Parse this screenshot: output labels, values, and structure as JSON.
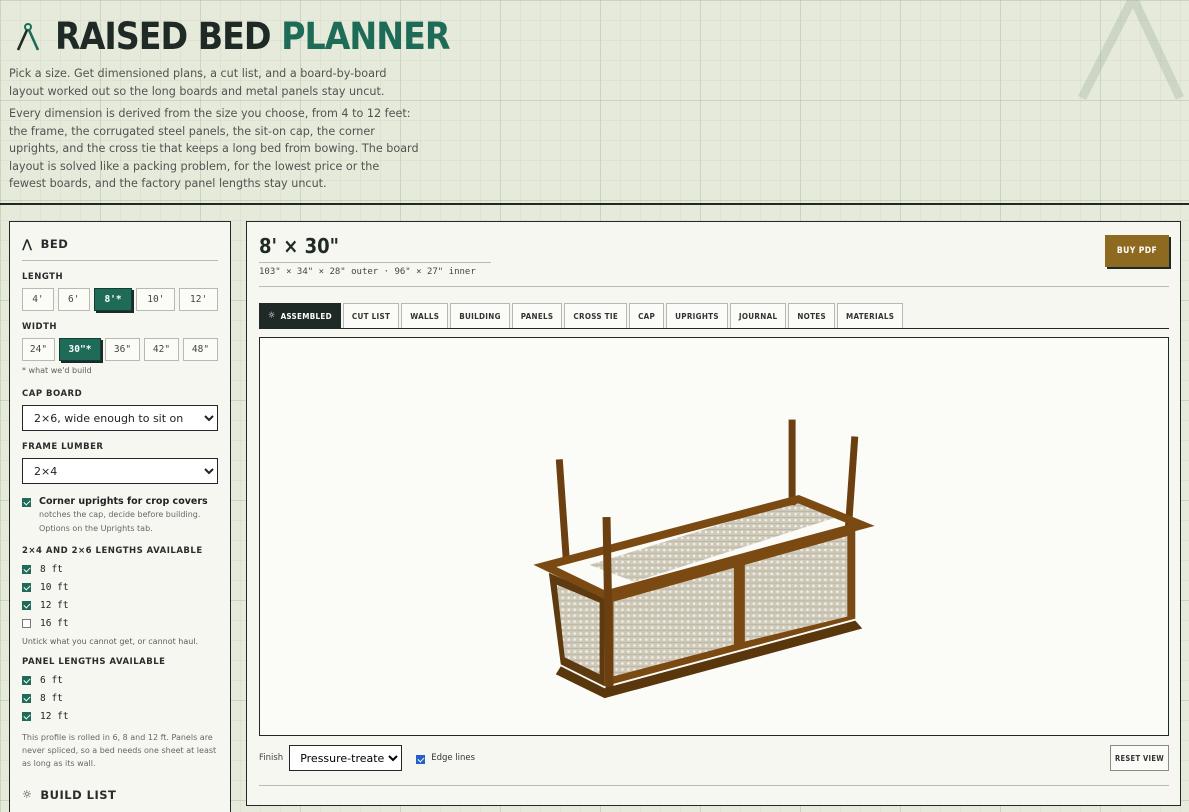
{
  "app": {
    "title_part1": "RAISED BED",
    "title_part2": "PLANNER",
    "intro1": "Pick a size. Get dimensioned plans, a cut list, and a board-by-board layout worked out so the long boards and metal panels stay uncut.",
    "intro2": "Every dimension is derived from the size you choose, from 4 to 12 feet: the frame, the corrugated steel panels, the sit-on cap, the corner uprights, and the cross tie that keeps a long bed from bowing. The board layout is solved like a packing problem, for the lowest price or the fewest boards, and the factory panel lengths stay uncut."
  },
  "sidebar": {
    "bed_heading": "BED",
    "length_label": "LENGTH",
    "lengths": [
      {
        "label": "4'",
        "selected": false
      },
      {
        "label": "6'",
        "selected": false
      },
      {
        "label": "8'*",
        "selected": true
      },
      {
        "label": "10'",
        "selected": false
      },
      {
        "label": "12'",
        "selected": false
      }
    ],
    "width_label": "WIDTH",
    "widths": [
      {
        "label": "24\"",
        "selected": false
      },
      {
        "label": "30\"*",
        "selected": true
      },
      {
        "label": "36\"",
        "selected": false
      },
      {
        "label": "42\"",
        "selected": false
      },
      {
        "label": "48\"",
        "selected": false
      }
    ],
    "width_note": "* what we'd build",
    "cap_label": "CAP BOARD",
    "cap_value": "2×6, wide enough to sit on",
    "frame_label": "FRAME LUMBER",
    "frame_value": "2×4",
    "uprights_title": "Corner uprights for crop covers",
    "uprights_sub": "notches the cap, decide before building. Options on the Uprights tab.",
    "uprights_checked": true,
    "lengths_avail_label": "2×4 AND 2×6 LENGTHS AVAILABLE",
    "lumber_lengths": [
      {
        "label": "8 ft",
        "checked": true
      },
      {
        "label": "10 ft",
        "checked": true
      },
      {
        "label": "12 ft",
        "checked": true
      },
      {
        "label": "16 ft",
        "checked": false
      }
    ],
    "lumber_note": "Untick what you cannot get, or cannot haul.",
    "panel_label": "PANEL LENGTHS AVAILABLE",
    "panel_lengths": [
      {
        "label": "6 ft",
        "checked": true
      },
      {
        "label": "8 ft",
        "checked": true
      },
      {
        "label": "12 ft",
        "checked": true
      }
    ],
    "panel_note": "This profile is rolled in 6, 8 and 12 ft. Panels are never spliced, so a bed needs one sheet at least as long as its wall.",
    "build_list_heading": "BUILD LIST"
  },
  "main": {
    "size_title": "8' × 30\"",
    "dims": "103\" × 34\" × 28\" outer · 96\" × 27\" inner",
    "buy_label": "BUY PDF",
    "tabs": [
      {
        "label": "ASSEMBLED",
        "active": true
      },
      {
        "label": "CUT LIST",
        "active": false
      },
      {
        "label": "WALLS",
        "active": false
      },
      {
        "label": "BUILDING",
        "active": false
      },
      {
        "label": "PANELS",
        "active": false
      },
      {
        "label": "CROSS TIE",
        "active": false
      },
      {
        "label": "CAP",
        "active": false
      },
      {
        "label": "UPRIGHTS",
        "active": false
      },
      {
        "label": "JOURNAL",
        "active": false
      },
      {
        "label": "NOTES",
        "active": false
      },
      {
        "label": "MATERIALS",
        "active": false
      }
    ],
    "finish_label": "Finish",
    "finish_value": "Pressure-treated",
    "edge_lines_label": "Edge lines",
    "edge_lines_checked": true,
    "reset_label": "RESET VIEW"
  },
  "colors": {
    "accent_green": "#1e6b57",
    "dark": "#1f2a26",
    "buy_gold": "#8d6a1f",
    "wood": "#7a4a12"
  }
}
